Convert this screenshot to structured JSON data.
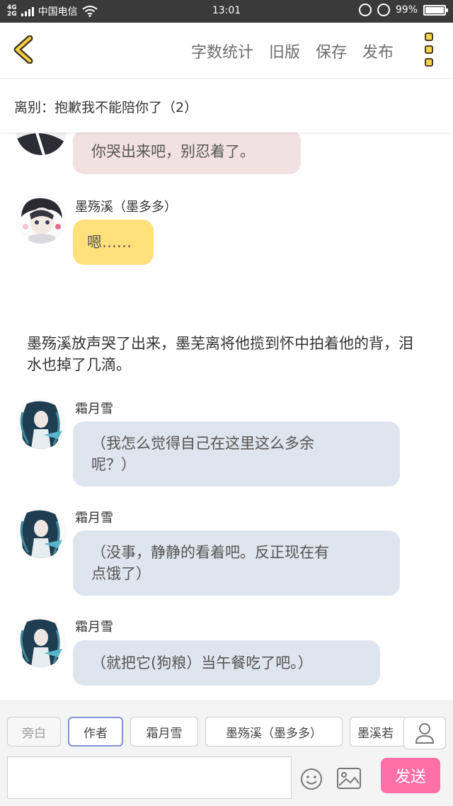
{
  "status_bar": {
    "network_top": "4G",
    "network_bottom": "2G",
    "carrier": "中国电信",
    "time": "13:01",
    "battery": "99%"
  },
  "header": {
    "actions": [
      "字数统计",
      "旧版",
      "保存",
      "发布"
    ]
  },
  "chapter_title": "离别：抱歉我不能陪你了（2）",
  "messages": {
    "m1": {
      "text": "你哭出来吧，别忍着了。",
      "bubble_color": "#f2e1e3"
    },
    "m2": {
      "name": "墨殇溪（墨多多）",
      "text": "嗯……",
      "bubble_color": "#ffe07a"
    },
    "narration": "墨殇溪放声哭了出来，墨芜离将他揽到怀中拍着他的背，泪水也掉了几滴。",
    "m3": {
      "name": "霜月雪",
      "line1": "（我怎么觉得自己在这里这么多余",
      "line2": "呢？）",
      "bubble_color": "#dfe5ee"
    },
    "m4": {
      "name": "霜月雪",
      "line1": "（没事，静静的看着吧。反正现在有",
      "line2": "点饿了）",
      "bubble_color": "#dfe5ee"
    },
    "m5": {
      "name": "霜月雪",
      "text": "（就把它(狗粮）当午餐吃了吧。）",
      "bubble_color": "#dfe5ee"
    }
  },
  "bottom_bar": {
    "roles": [
      "旁白",
      "作者",
      "霜月雪",
      "墨殇溪（墨多多）",
      "墨溪若"
    ],
    "input_placeholder": "",
    "send_label": "发送"
  },
  "colors": {
    "accent": "#ff6fa8",
    "selected_chip": "#7f96d3",
    "menu_yellow": "#f7d34a"
  }
}
